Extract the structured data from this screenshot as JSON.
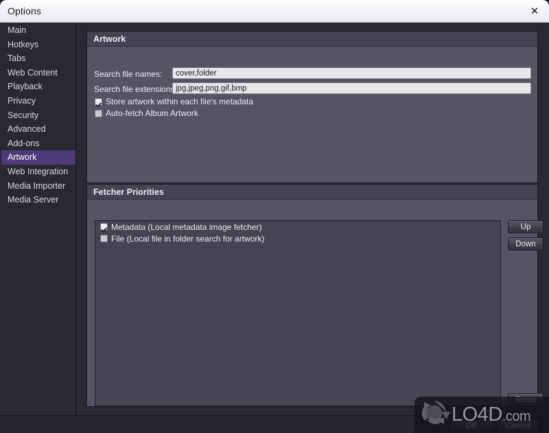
{
  "window": {
    "title": "Options",
    "close_icon": "close-icon",
    "close_glyph": "✕"
  },
  "sidebar": {
    "items": [
      {
        "label": "Main",
        "selected": false
      },
      {
        "label": "Hotkeys",
        "selected": false
      },
      {
        "label": "Tabs",
        "selected": false
      },
      {
        "label": "Web Content",
        "selected": false
      },
      {
        "label": "Playback",
        "selected": false
      },
      {
        "label": "Privacy",
        "selected": false
      },
      {
        "label": "Security",
        "selected": false
      },
      {
        "label": "Advanced",
        "selected": false
      },
      {
        "label": "Add-ons",
        "selected": false
      },
      {
        "label": "Artwork",
        "selected": true
      },
      {
        "label": "Web Integration",
        "selected": false
      },
      {
        "label": "Media Importer",
        "selected": false
      },
      {
        "label": "Media Server",
        "selected": false
      }
    ],
    "selected_color": "#4b3b78"
  },
  "artwork": {
    "title": "Artwork",
    "search_names_label": "Search file names:",
    "search_names_value": "cover,folder",
    "search_ext_label": "Search file extensions:",
    "search_ext_value": "jpg,jpeg,png,gif,bmp",
    "store_metadata_label": "Store artwork within each file's metadata",
    "store_metadata_checked": true,
    "autofetch_label": "Auto-fetch Album Artwork",
    "autofetch_checked": false
  },
  "fetcher": {
    "title": "Fetcher Priorities",
    "items": [
      {
        "label": "Metadata (Local metadata image fetcher)",
        "checked": true
      },
      {
        "label": "File (Local file in folder search for artwork)",
        "checked": false
      }
    ],
    "up_label": "Up",
    "down_label": "Down",
    "reset_label": "Reset"
  },
  "dialog": {
    "ok_label": "OK",
    "cancel_label": "Cancel"
  },
  "watermark": {
    "logo_icon": "refresh-cycle-logo-icon",
    "text": "LO4D",
    "suffix": ".com"
  }
}
